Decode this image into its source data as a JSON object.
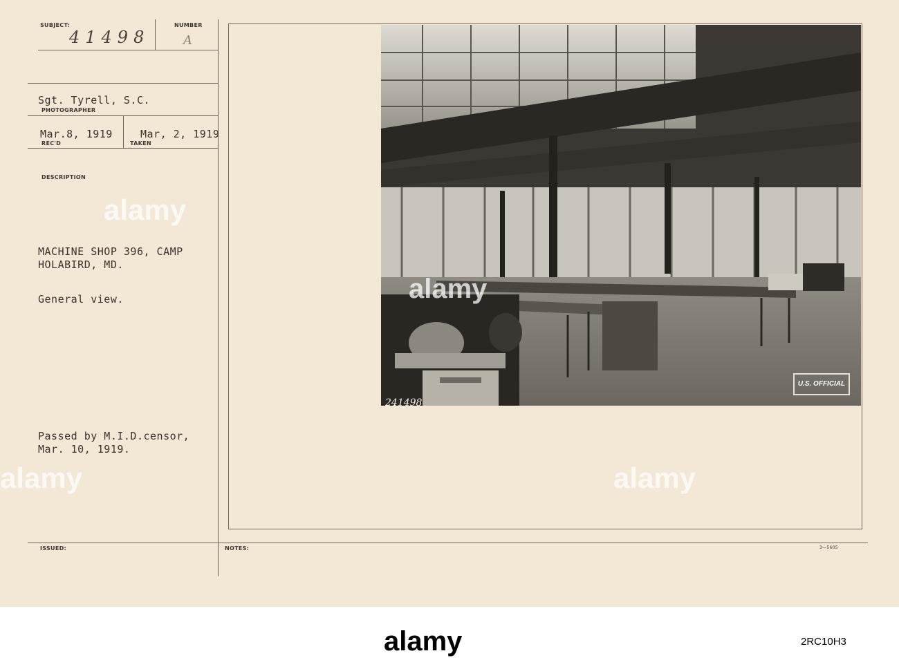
{
  "card": {
    "subject_label": "SUBJECT:",
    "subject_value": "41498",
    "number_label": "NUMBER",
    "number_value": "A",
    "photographer_name": "Sgt. Tyrell, S.C.",
    "photographer_label": "PHOTOGRAPHER",
    "recd_date": "Mar.8, 1919",
    "recd_label": "REC'D",
    "taken_date": "Mar, 2, 1919",
    "taken_label": "TAKEN",
    "description_label": "DESCRIPTION",
    "description_line1": "MACHINE SHOP 396, CAMP",
    "description_line2": "HOLABIRD, MD.",
    "description_line3": "General view.",
    "censor_line1": "Passed by M.I.D.censor,",
    "censor_line2": "Mar. 10, 1919.",
    "issued_label": "ISSUED:",
    "notes_label": "NOTES:",
    "form_code": "3—5605"
  },
  "photo": {
    "negative_number": "241498",
    "stamp_text": "U.S. OFFICIAL"
  },
  "watermarks": {
    "text": "alamy"
  },
  "footer": {
    "logo": "alamy",
    "image_id": "2RC10H3"
  }
}
